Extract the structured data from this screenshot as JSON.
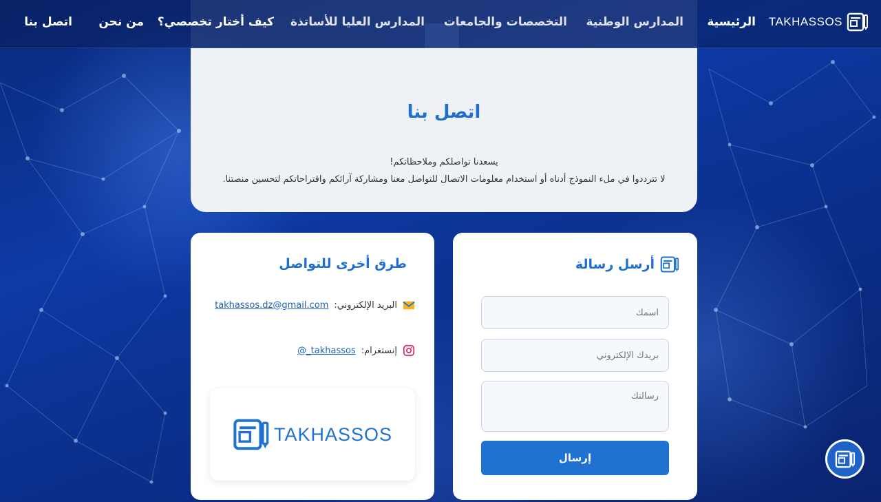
{
  "brand": {
    "name": "TAKHASSOS",
    "icon": "document-pencil-icon"
  },
  "nav": {
    "items": [
      {
        "label": "الرئيسية"
      },
      {
        "label": "المدارس الوطنية"
      },
      {
        "label": "التخصصات والجامعات"
      },
      {
        "label": "المدارس العليا للأساتذة"
      },
      {
        "label": "كيف أختار تخصصي؟"
      },
      {
        "label": "من نحن"
      },
      {
        "label": "اتصل بنا"
      }
    ]
  },
  "hero": {
    "title": "اتصل بنا",
    "line1": "يسعدنا تواصلكم وملاحظاتكم!",
    "line2": "لا تترددوا في ملء النموذج أدناه أو استخدام معلومات الاتصال للتواصل معنا ومشاركة آرائكم واقتراحاتكم لتحسين منصتنا."
  },
  "form": {
    "title": "أرسل رسالة",
    "name_placeholder": "اسمك",
    "email_placeholder": "بريدك الإلكتروني",
    "message_placeholder": "رسالتك",
    "submit_label": "إرسال"
  },
  "contact": {
    "title": "طرق أخرى للتواصل",
    "email_label": "البريد الإلكتروني:",
    "email_value": "takhassos.dz@gmail.com",
    "insta_label": "إنستغرام:",
    "insta_value": "takhassos_@"
  },
  "logo": {
    "text": "TAKHASSOS"
  },
  "colors": {
    "accent": "#1f72cf",
    "title": "#1f6fd1",
    "background": "#0d3aa5"
  }
}
